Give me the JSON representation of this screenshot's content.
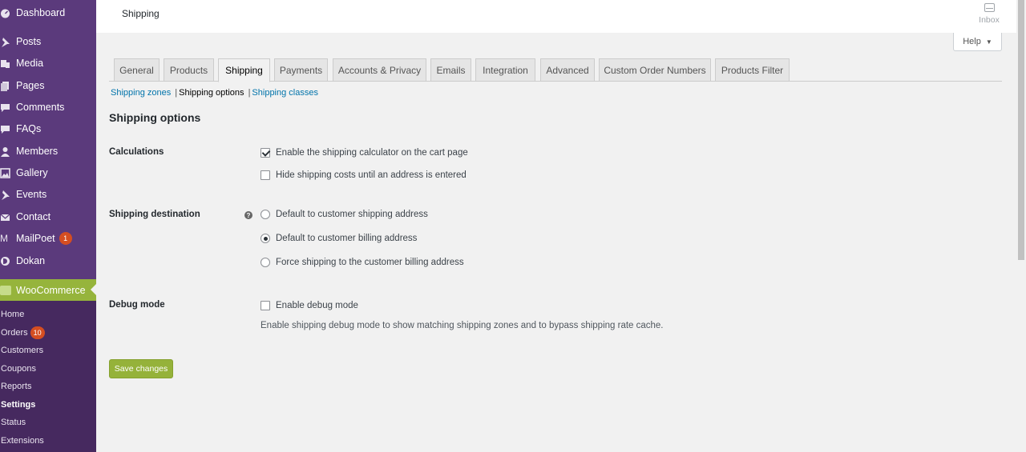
{
  "sidebar": {
    "items": [
      {
        "label": "Dashboard",
        "icon": "dashboard-icon"
      },
      {
        "label": "Posts",
        "icon": "pin-icon"
      },
      {
        "label": "Media",
        "icon": "media-icon"
      },
      {
        "label": "Pages",
        "icon": "pages-icon"
      },
      {
        "label": "Comments",
        "icon": "comment-icon"
      },
      {
        "label": "FAQs",
        "icon": "comment-icon"
      },
      {
        "label": "Members",
        "icon": "user-icon"
      },
      {
        "label": "Gallery",
        "icon": "gallery-icon"
      },
      {
        "label": "Events",
        "icon": "pin-icon"
      },
      {
        "label": "Contact",
        "icon": "mail-icon"
      },
      {
        "label": "MailPoet",
        "icon": "mailpoet-icon",
        "badge": "1"
      },
      {
        "label": "Dokan",
        "icon": "dokan-icon"
      }
    ],
    "woocommerce": {
      "label": "WooCommerce"
    },
    "submenu": [
      {
        "label": "Home"
      },
      {
        "label": "Orders",
        "badge": "10"
      },
      {
        "label": "Customers"
      },
      {
        "label": "Coupons"
      },
      {
        "label": "Reports"
      },
      {
        "label": "Settings",
        "current": true
      },
      {
        "label": "Status"
      },
      {
        "label": "Extensions"
      }
    ]
  },
  "header": {
    "title": "Shipping",
    "inbox_label": "Inbox",
    "help_label": "Help"
  },
  "tabs": [
    {
      "label": "General"
    },
    {
      "label": "Products"
    },
    {
      "label": "Shipping",
      "active": true
    },
    {
      "label": "Payments"
    },
    {
      "label": "Accounts & Privacy"
    },
    {
      "label": "Emails"
    },
    {
      "label": "Integration"
    },
    {
      "label": "Advanced"
    },
    {
      "label": "Custom Order Numbers"
    },
    {
      "label": "Products Filter"
    }
  ],
  "subnav": {
    "zones": "Shipping zones",
    "options": "Shipping options",
    "classes": "Shipping classes",
    "separator": "|"
  },
  "section": {
    "title": "Shipping options"
  },
  "calculations": {
    "label": "Calculations",
    "enable_calculator": {
      "label": "Enable the shipping calculator on the cart page",
      "checked": true
    },
    "hide_costs": {
      "label": "Hide shipping costs until an address is entered",
      "checked": false
    }
  },
  "destination": {
    "label": "Shipping destination",
    "help_glyph": "?",
    "options": [
      {
        "label": "Default to customer shipping address",
        "checked": false
      },
      {
        "label": "Default to customer billing address",
        "checked": true
      },
      {
        "label": "Force shipping to the customer billing address",
        "checked": false
      }
    ]
  },
  "debug": {
    "label": "Debug mode",
    "checkbox_label": "Enable debug mode",
    "checked": false,
    "description": "Enable shipping debug mode to show matching shipping zones and to bypass shipping rate cache."
  },
  "save_label": "Save changes",
  "colors": {
    "sidebar": "#5b3a7c",
    "submenu": "#46295f",
    "woo_active": "#96b43c",
    "save_button": "#95b23a",
    "link": "#0073aa",
    "badge": "#d54e21"
  }
}
